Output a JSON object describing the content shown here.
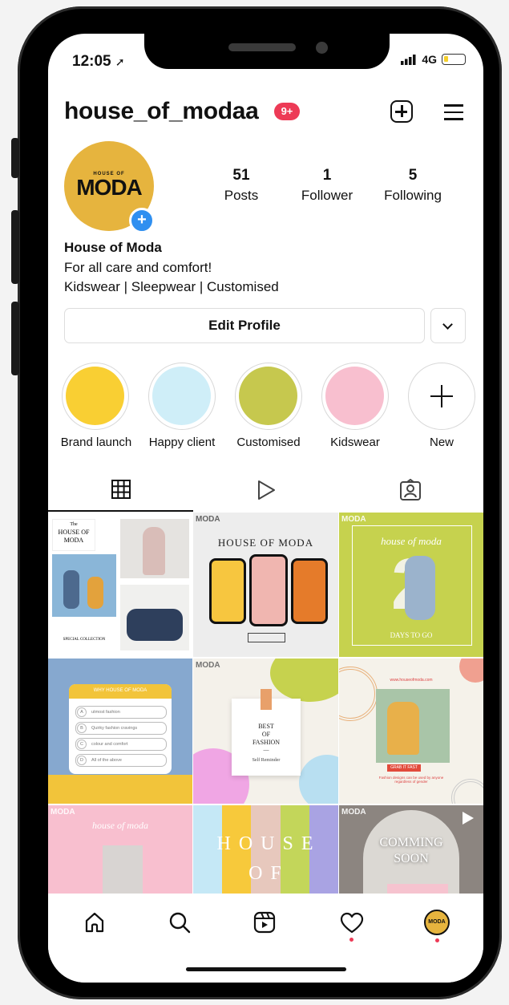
{
  "status_bar": {
    "time": "12:05",
    "network": "4G"
  },
  "header": {
    "username": "house_of_modaa",
    "notif_badge": "9+"
  },
  "profile": {
    "avatar_small": "HOUSE OF",
    "avatar_big": "MODA",
    "stats": [
      {
        "value": "51",
        "label": "Posts"
      },
      {
        "value": "1",
        "label": "Follower"
      },
      {
        "value": "5",
        "label": "Following"
      }
    ],
    "name": "House of Moda",
    "bio_line1": "For all care and comfort!",
    "bio_line2": "Kidswear | Sleepwear | Customised",
    "edit_label": "Edit Profile"
  },
  "highlights": [
    {
      "label": "Brand launch",
      "color": "#f9cf33"
    },
    {
      "label": "Happy client",
      "color": "#cfeef8"
    },
    {
      "label": "Customised",
      "color": "#c6c84e"
    },
    {
      "label": "Kidswear",
      "color": "#f8bfcf"
    },
    {
      "label": "New"
    }
  ],
  "posts": {
    "p1_line1": "The",
    "p1_line2": "HOUSE OF",
    "p1_line3": "MODA",
    "p1_sub": "SPECIAL COLLECTION",
    "p2_tag": "MODA",
    "p2_title": "HOUSE OF MODA",
    "p3_tag": "MODA",
    "p3_script": "house of moda",
    "p3_num": "2",
    "p3_days": "DAYS TO GO",
    "p4_title": "WHY HOUSE OF MODA",
    "p4_options": [
      "utmost fashion",
      "Quirky fashion cravings",
      "colour and comfort",
      "All of the above"
    ],
    "p4_letters": [
      "A",
      "B",
      "C",
      "D"
    ],
    "p5_tag": "MODA",
    "p5_l1": "BEST",
    "p5_l2": "OF",
    "p5_l3": "FASHION",
    "p5_dash": "—",
    "p5_sub": "Self Reminder",
    "p6_url": "www.houseofmoda.com",
    "p6_btn": "GRAB IT FAST",
    "p6_small": "Fashion designs can be used by anyone regardless of gender",
    "p7_tag": "MODA",
    "p7_script": "house of moda",
    "p8_l1": "H O U S E",
    "p8_l2": "O F",
    "p9_tag": "MODA",
    "p9_l1": "COMMING",
    "p9_l2": "SOON"
  },
  "colors": {
    "accent": "#ed3a56",
    "avatar_bg": "#e6b43e",
    "blue": "#2f8ff0"
  }
}
